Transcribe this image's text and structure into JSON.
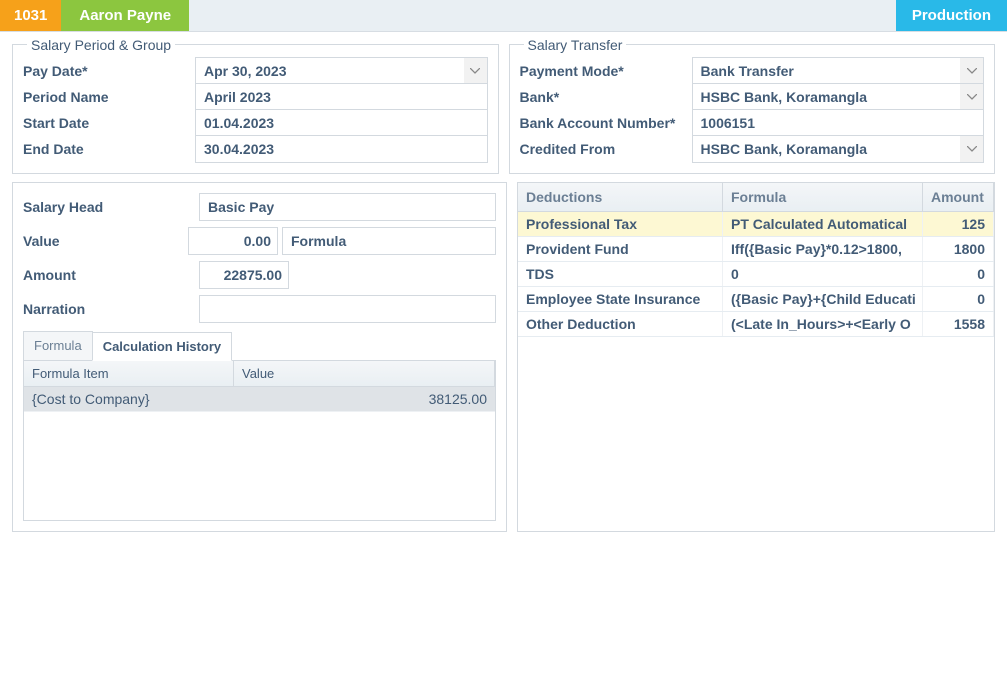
{
  "header": {
    "employee_id": "1031",
    "employee_name": "Aaron Payne",
    "production_label": "Production"
  },
  "salary_period_group": {
    "legend": "Salary Period & Group",
    "pay_date_label": "Pay Date*",
    "pay_date": "Apr 30, 2023",
    "period_name_label": "Period Name",
    "period_name": "April 2023",
    "start_date_label": "Start Date",
    "start_date": "01.04.2023",
    "end_date_label": "End Date",
    "end_date": "30.04.2023"
  },
  "salary_transfer": {
    "legend": "Salary Transfer",
    "payment_mode_label": "Payment Mode*",
    "payment_mode": "Bank Transfer",
    "bank_label": "Bank*",
    "bank": "HSBC Bank, Koramangla",
    "account_number_label": "Bank Account Number*",
    "account_number": "1006151",
    "credited_from_label": "Credited From",
    "credited_from": "HSBC Bank, Koramangla"
  },
  "salary_detail": {
    "head_label": "Salary Head",
    "head": "Basic Pay",
    "value_label": "Value",
    "value": "0.00",
    "formula_label": "Formula",
    "amount_label": "Amount",
    "amount": "22875.00",
    "narration_label": "Narration",
    "narration": ""
  },
  "tabs": {
    "formula": "Formula",
    "calc_history": "Calculation History"
  },
  "calc_history": {
    "col_item": "Formula Item",
    "col_value": "Value",
    "rows": [
      {
        "item": "{Cost to Company}",
        "value": "38125.00"
      }
    ]
  },
  "deductions_table": {
    "col_name": "Deductions",
    "col_formula": "Formula",
    "col_amount": "Amount",
    "rows": [
      {
        "name": "Professional Tax",
        "formula": "PT Calculated Automatical",
        "amount": "125"
      },
      {
        "name": "Provident Fund",
        "formula": "Iff({Basic Pay}*0.12>1800,",
        "amount": "1800"
      },
      {
        "name": "TDS",
        "formula": "0",
        "amount": "0"
      },
      {
        "name": "Employee State Insurance",
        "formula": "({Basic Pay}+{Child Educati",
        "amount": "0"
      },
      {
        "name": "Other Deduction",
        "formula": "(<Late In_Hours>+<Early O",
        "amount": "1558"
      }
    ]
  }
}
